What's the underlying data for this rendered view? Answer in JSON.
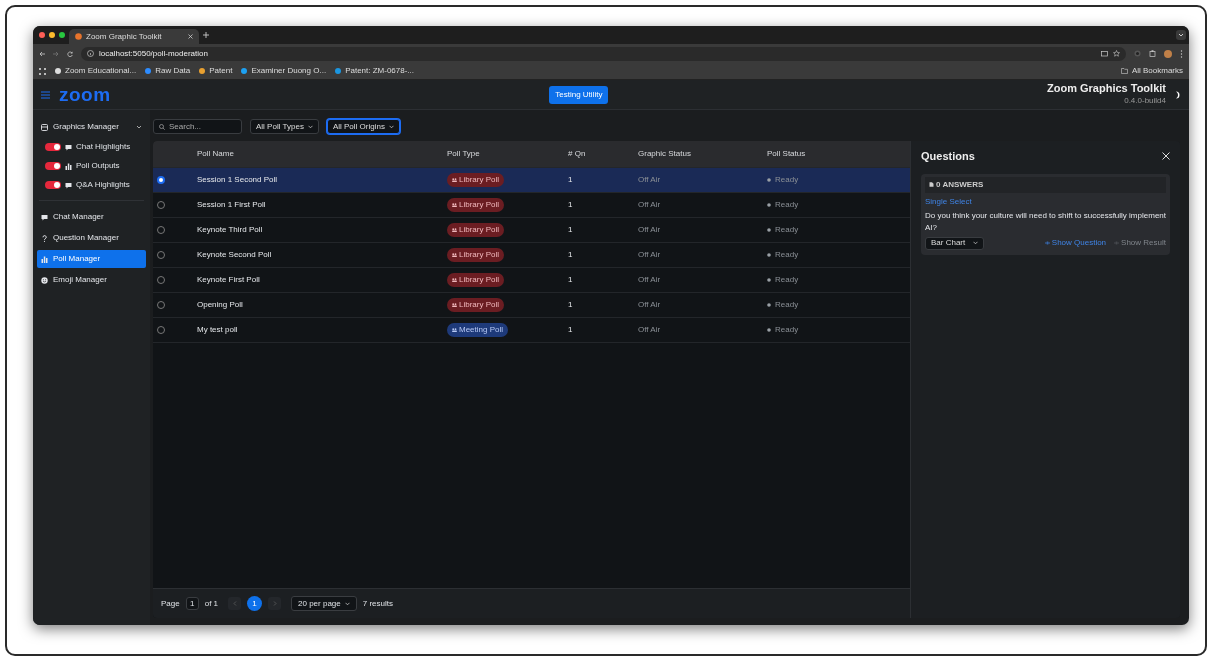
{
  "browser": {
    "tab_title": "Zoom Graphic Toolkit",
    "url": "localhost:5050/poll-moderation",
    "bookmarks": [
      "Zoom Educational...",
      "Raw Data",
      "Patent",
      "Examiner Duong O...",
      "Patent: ZM-0678-..."
    ],
    "all_bookmarks": "All Bookmarks"
  },
  "header": {
    "brand": "zoom",
    "utility_button": "Testing Utility",
    "title": "Zoom Graphics Toolkit",
    "version": "0.4.0-build4"
  },
  "sidebar": {
    "group": {
      "label": "Graphics Manager",
      "expanded": true,
      "toggles": [
        {
          "label": "Chat Highlights",
          "kind": "chat",
          "on": true
        },
        {
          "label": "Poll Outputs",
          "kind": "poll",
          "on": true
        },
        {
          "label": "Q&A Highlights",
          "kind": "chat",
          "on": true
        }
      ]
    },
    "items": [
      {
        "label": "Chat Manager",
        "kind": "chat",
        "selected": false
      },
      {
        "label": "Question Manager",
        "kind": "question",
        "selected": false
      },
      {
        "label": "Poll Manager",
        "kind": "poll",
        "selected": true
      },
      {
        "label": "Emoji Manager",
        "kind": "emoji",
        "selected": false
      }
    ]
  },
  "filters": {
    "search": {
      "placeholder": "Search..."
    },
    "selects": [
      {
        "value": "All Poll Types",
        "focused": false
      },
      {
        "value": "All Poll Origins",
        "focused": true
      }
    ]
  },
  "table": {
    "columns": [
      "Poll Name",
      "Poll Type",
      "# Qn",
      "Graphic Status",
      "Poll Status"
    ],
    "rows": [
      {
        "selected": true,
        "name": "Session 1 Second Poll",
        "type": {
          "label": "Library Poll",
          "kind": "library"
        },
        "qn": "1",
        "graphic_status": "Off Air",
        "poll_status": "Ready"
      },
      {
        "selected": false,
        "name": "Session 1 First Poll",
        "type": {
          "label": "Library Poll",
          "kind": "library"
        },
        "qn": "1",
        "graphic_status": "Off Air",
        "poll_status": "Ready"
      },
      {
        "selected": false,
        "name": "Keynote Third Poll",
        "type": {
          "label": "Library Poll",
          "kind": "library"
        },
        "qn": "1",
        "graphic_status": "Off Air",
        "poll_status": "Ready"
      },
      {
        "selected": false,
        "name": "Keynote Second Poll",
        "type": {
          "label": "Library Poll",
          "kind": "library"
        },
        "qn": "1",
        "graphic_status": "Off Air",
        "poll_status": "Ready"
      },
      {
        "selected": false,
        "name": "Keynote First Poll",
        "type": {
          "label": "Library Poll",
          "kind": "library"
        },
        "qn": "1",
        "graphic_status": "Off Air",
        "poll_status": "Ready"
      },
      {
        "selected": false,
        "name": "Opening Poll",
        "type": {
          "label": "Library Poll",
          "kind": "library"
        },
        "qn": "1",
        "graphic_status": "Off Air",
        "poll_status": "Ready"
      },
      {
        "selected": false,
        "name": "My test poll",
        "type": {
          "label": "Meeting Poll",
          "kind": "meeting"
        },
        "qn": "1",
        "graphic_status": "Off Air",
        "poll_status": "Ready"
      }
    ]
  },
  "pagination": {
    "page_label": "Page",
    "page_value": "1",
    "of_label": "of 1",
    "pages": [
      {
        "label": "1",
        "selected": true
      }
    ],
    "per_page": "20 per page",
    "results": "7 results"
  },
  "questions": {
    "title": "Questions",
    "cards": [
      {
        "answers": "0 ANSWERS",
        "type": "Single Select",
        "text": "Do you think your culture will need to shift to successfully implement AI?",
        "chart_select": "Bar Chart",
        "show_question": {
          "label": "Show Question",
          "disabled": false
        },
        "show_result": {
          "label": "Show Result",
          "disabled": true
        }
      }
    ]
  }
}
